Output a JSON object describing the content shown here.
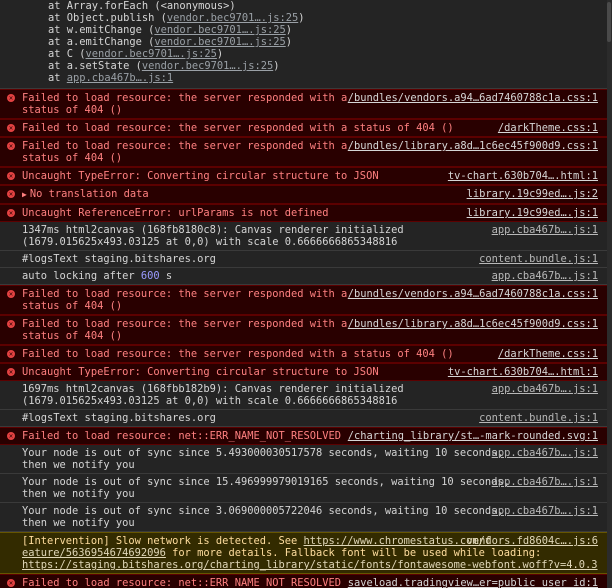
{
  "stack_trace": [
    {
      "prefix": "at Array.forEach (<anonymous>)",
      "link": ""
    },
    {
      "prefix": "at Object.publish (",
      "link": "vendor.bec9701….js:25",
      "suffix": ")"
    },
    {
      "prefix": "at w.emitChange (",
      "link": "vendor.bec9701….js:25",
      "suffix": ")"
    },
    {
      "prefix": "at a.emitChange (",
      "link": "vendor.bec9701….js:25",
      "suffix": ")"
    },
    {
      "prefix": "at C (",
      "link": "vendor.bec9701….js:25",
      "suffix": ")"
    },
    {
      "prefix": "at a.setState (",
      "link": "vendor.bec9701….js:25",
      "suffix": ")"
    },
    {
      "prefix": "at ",
      "link": "app.cba467b….js:1",
      "suffix": ""
    }
  ],
  "entries": [
    {
      "type": "error",
      "text": "Failed to load resource: the server responded with a\nstatus of 404 ()",
      "source": "/bundles/vendors.a94…6ad7460788c1a.css:1"
    },
    {
      "type": "error",
      "text": "Failed to load resource: the server responded with a status of 404 ()",
      "source": "/darkTheme.css:1"
    },
    {
      "type": "error",
      "text": "Failed to load resource: the server responded with a\nstatus of 404 ()",
      "source": "/bundles/library.a8d…1c6ec45f900d9.css:1"
    },
    {
      "type": "error",
      "text": "Uncaught TypeError: Converting circular structure to JSON",
      "source": "tv-chart.630b704….html:1"
    },
    {
      "type": "error",
      "text": "No translation data",
      "source": "library.19c99ed….js:2",
      "triangle": "true"
    },
    {
      "type": "error",
      "text": "Uncaught ReferenceError: urlParams is not defined",
      "source": "library.19c99ed….js:1"
    },
    {
      "type": "log",
      "text": "1347ms html2canvas (168fb8180c8): Canvas renderer initialized\n(1679.015625x493.03125 at 0,0) with scale 0.6666666865348816",
      "source": "app.cba467b….js:1"
    },
    {
      "type": "log",
      "text": "#logsText staging.bitshares.org",
      "source": "content.bundle.js:1"
    },
    {
      "type": "log",
      "text": "auto locking after ",
      "num": "600",
      "after": " s",
      "source": "app.cba467b….js:1"
    },
    {
      "type": "error",
      "text": "Failed to load resource: the server responded with a\nstatus of 404 ()",
      "source": "/bundles/vendors.a94…6ad7460788c1a.css:1"
    },
    {
      "type": "error",
      "text": "Failed to load resource: the server responded with a\nstatus of 404 ()",
      "source": "/bundles/library.a8d…1c6ec45f900d9.css:1"
    },
    {
      "type": "error",
      "text": "Failed to load resource: the server responded with a status of 404 ()",
      "source": "/darkTheme.css:1"
    },
    {
      "type": "error",
      "text": "Uncaught TypeError: Converting circular structure to JSON",
      "source": "tv-chart.630b704….html:1"
    },
    {
      "type": "log",
      "text": "1697ms html2canvas (168fbb182b9): Canvas renderer initialized\n(1679.015625x493.03125 at 0,0) with scale 0.6666666865348816",
      "source": "app.cba467b….js:1"
    },
    {
      "type": "log",
      "text": "#logsText staging.bitshares.org",
      "source": "content.bundle.js:1"
    },
    {
      "type": "error",
      "text": "Failed to load resource: net::ERR_NAME_NOT_RESOLVED",
      "source": "/charting_library/st…-mark-rounded.svg:1"
    },
    {
      "type": "log",
      "text": "Your node is out of sync since 5.493000030517578 seconds, waiting 10 seconds,\nthen we notify you",
      "source": "app.cba467b….js:1"
    },
    {
      "type": "log",
      "text": "Your node is out of sync since 15.496999979019165 seconds, waiting 10 seconds,\nthen we notify you",
      "source": "app.cba467b….js:1"
    },
    {
      "type": "log",
      "text": "Your node is out of sync since 3.069000005722046 seconds, waiting 10 seconds,\nthen we notify you",
      "source": "app.cba467b….js:1"
    },
    {
      "type": "warn",
      "text": "[Intervention] Slow network is detected. See ",
      "link1": "https://www.chromestatus.com/f\neature/5636954674692096",
      "mid": " for more details. Fallback font will be used while loading: ",
      "link2": "https://staging.bitshares.org/charting_library/static/fonts/fontawesome-webfont.woff?v=4.0.3",
      "source": "vendors.fd8604c….js:6"
    },
    {
      "type": "error",
      "text": "Failed to load resource: net::ERR_NAME_NOT_RESOLVED",
      "source": "saveload.tradingview…er=public_user_id:1"
    }
  ]
}
